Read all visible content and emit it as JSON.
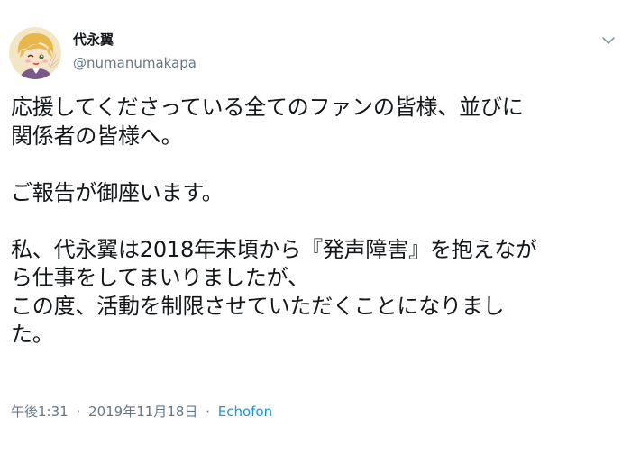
{
  "user": {
    "display_name": "代永翼",
    "handle": "@numanumakapa"
  },
  "tweet": {
    "lines": [
      "応援してくださっている全てのファンの皆様、並びに",
      "関係者の皆様へ。",
      "",
      "ご報告が御座います。",
      "",
      "私、代永翼は2018年末頃から『発声障害』を抱えなが",
      "ら仕事をしてまいりましたが、",
      "この度、活動を制限させていただくことになりまし",
      "た。"
    ]
  },
  "meta": {
    "time": "午後1:31",
    "separator": "·",
    "date": "2019年11月18日",
    "source": "Echofon"
  },
  "icons": {
    "menu": "chevron-down-icon",
    "avatar": "avatar"
  },
  "colors": {
    "text": "#14171a",
    "secondary": "#657786",
    "link": "#1b95e0"
  }
}
